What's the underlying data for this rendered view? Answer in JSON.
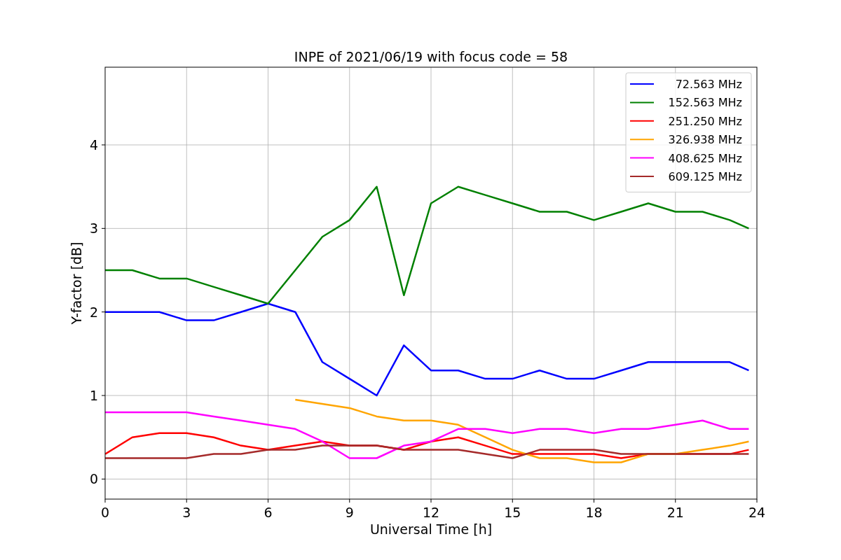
{
  "figure": {
    "chart_data": {
      "type": "line",
      "title": "INPE of 2021/06/19 with focus code = 58",
      "xlabel": "Universal Time [h]",
      "ylabel": "Y-factor [dB]",
      "x": [
        0,
        1,
        2,
        3,
        4,
        5,
        6,
        7,
        8,
        9,
        10,
        11,
        12,
        13,
        14,
        15,
        16,
        17,
        18,
        19,
        20,
        21,
        22,
        23,
        23.7
      ],
      "series": [
        {
          "name": "72.563 MHz",
          "color": "#0000ff",
          "values": [
            2.0,
            2.0,
            2.0,
            1.9,
            1.9,
            2.0,
            2.1,
            2.0,
            1.4,
            1.2,
            1.0,
            1.6,
            1.3,
            1.3,
            1.2,
            1.2,
            1.3,
            1.2,
            1.2,
            1.3,
            1.4,
            1.4,
            1.4,
            1.4,
            1.3
          ]
        },
        {
          "name": "152.563 MHz",
          "color": "#008000",
          "values": [
            2.5,
            2.5,
            2.4,
            2.4,
            2.3,
            2.2,
            2.1,
            2.5,
            2.9,
            3.1,
            3.5,
            2.2,
            3.3,
            3.5,
            3.4,
            3.3,
            3.2,
            3.2,
            3.1,
            3.2,
            3.3,
            3.2,
            3.2,
            3.1,
            3.0
          ]
        },
        {
          "name": "251.250 MHz",
          "color": "#ff0000",
          "values": [
            0.3,
            0.5,
            0.55,
            0.55,
            0.5,
            0.4,
            0.35,
            0.4,
            0.45,
            0.4,
            0.4,
            0.35,
            0.45,
            0.5,
            0.4,
            0.3,
            0.3,
            0.3,
            0.3,
            0.25,
            0.3,
            0.3,
            0.3,
            0.3,
            0.35
          ]
        },
        {
          "name": "326.938 MHz",
          "color": "#ffa500",
          "values": [
            null,
            null,
            null,
            null,
            null,
            null,
            null,
            0.95,
            0.9,
            0.85,
            0.75,
            0.7,
            0.7,
            0.65,
            0.5,
            0.35,
            0.25,
            0.25,
            0.2,
            0.2,
            0.3,
            0.3,
            0.35,
            0.4,
            0.45
          ]
        },
        {
          "name": "408.625 MHz",
          "color": "#ff00ff",
          "values": [
            0.8,
            0.8,
            0.8,
            0.8,
            0.75,
            0.7,
            0.65,
            0.6,
            0.45,
            0.25,
            0.25,
            0.4,
            0.45,
            0.6,
            0.6,
            0.55,
            0.6,
            0.6,
            0.55,
            0.6,
            0.6,
            0.65,
            0.7,
            0.6,
            0.6
          ]
        },
        {
          "name": "609.125 MHz",
          "color": "#a52a2a",
          "values": [
            0.25,
            0.25,
            0.25,
            0.25,
            0.3,
            0.3,
            0.35,
            0.35,
            0.4,
            0.4,
            0.4,
            0.35,
            0.35,
            0.35,
            0.3,
            0.25,
            0.35,
            0.35,
            0.35,
            0.3,
            0.3,
            0.3,
            0.3,
            0.3,
            0.3
          ]
        }
      ],
      "grid": true,
      "legend": true,
      "xlim": [
        0,
        24
      ],
      "ylim": [
        -0.24,
        4.93
      ],
      "xticks": [
        0,
        3,
        6,
        9,
        12,
        15,
        18,
        21,
        24
      ],
      "yticks": [
        0,
        1,
        2,
        3,
        4
      ]
    }
  }
}
